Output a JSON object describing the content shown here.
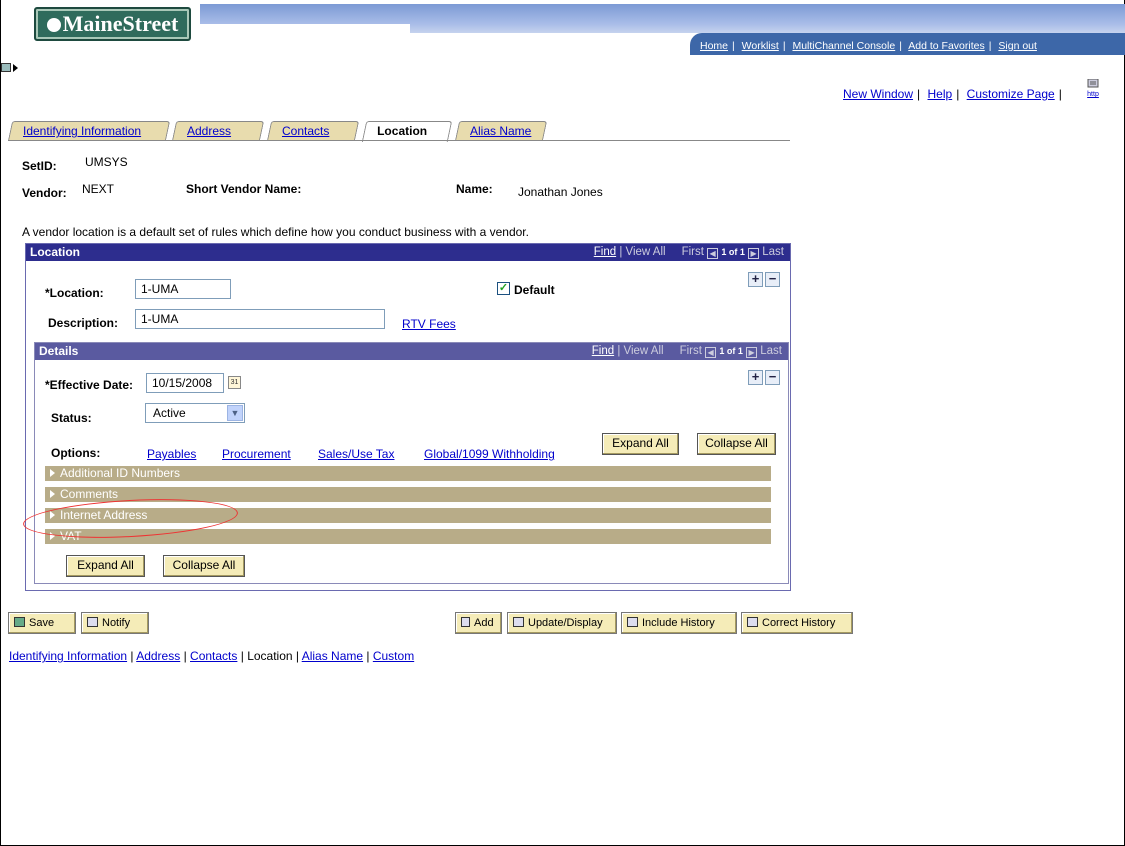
{
  "app": {
    "logo_text": "MaineStreet"
  },
  "top_nav": [
    "Home",
    "Worklist",
    "MultiChannel Console",
    "Add to Favorites",
    "Sign out"
  ],
  "page_links": {
    "new_window": "New Window",
    "help": "Help",
    "customize": "Customize Page",
    "http_icon_text": "http"
  },
  "tabs": [
    {
      "label": "Identifying Information",
      "active": false
    },
    {
      "label": "Address",
      "active": false
    },
    {
      "label": "Contacts",
      "active": false
    },
    {
      "label": "Location",
      "active": true
    },
    {
      "label": "Alias Name",
      "active": false
    }
  ],
  "header": {
    "setid_label": "SetID:",
    "setid_value": "UMSYS",
    "vendor_label": "Vendor:",
    "vendor_value": "NEXT",
    "short_name_label": "Short Vendor Name:",
    "name_label": "Name:",
    "name_value": "Jonathan Jones"
  },
  "description_text": "A vendor location is a default set of rules which define how you conduct business with a vendor.",
  "location_panel": {
    "title": "Location",
    "find": "Find",
    "view_all": "View All",
    "first": "First",
    "counter": "1 of 1",
    "last": "Last",
    "location_label": "*Location:",
    "location_value": "1-UMA",
    "default_label": "Default",
    "default_checked": true,
    "description_label": "Description:",
    "description_value": "1-UMA",
    "rtv_fees": "RTV Fees"
  },
  "details_panel": {
    "title": "Details",
    "find": "Find",
    "view_all": "View All",
    "first": "First",
    "counter": "1 of 1",
    "last": "Last",
    "effective_date_label": "*Effective Date:",
    "effective_date_value": "10/15/2008",
    "status_label": "Status:",
    "status_value": "Active",
    "options_label": "Options:",
    "options": [
      "Payables",
      "Procurement",
      "Sales/Use Tax",
      "Global/1099 Withholding"
    ],
    "expand_all": "Expand All",
    "collapse_all": "Collapse All",
    "collapsibles": [
      "Additional ID Numbers",
      "Comments",
      "Internet Address",
      "VAT"
    ]
  },
  "toolbar": {
    "save": "Save",
    "notify": "Notify",
    "add": "Add",
    "update_display": "Update/Display",
    "include_history": "Include History",
    "correct_history": "Correct History"
  },
  "bottom_links": [
    "Identifying Information",
    "Address",
    "Contacts",
    "Location",
    "Alias Name",
    "Custom"
  ],
  "colors": {
    "panel_header": "#2d2d8e",
    "tab_bg": "#e8dcae",
    "collapsible_bar": "#b8ac88",
    "annotation": "#e33333"
  }
}
